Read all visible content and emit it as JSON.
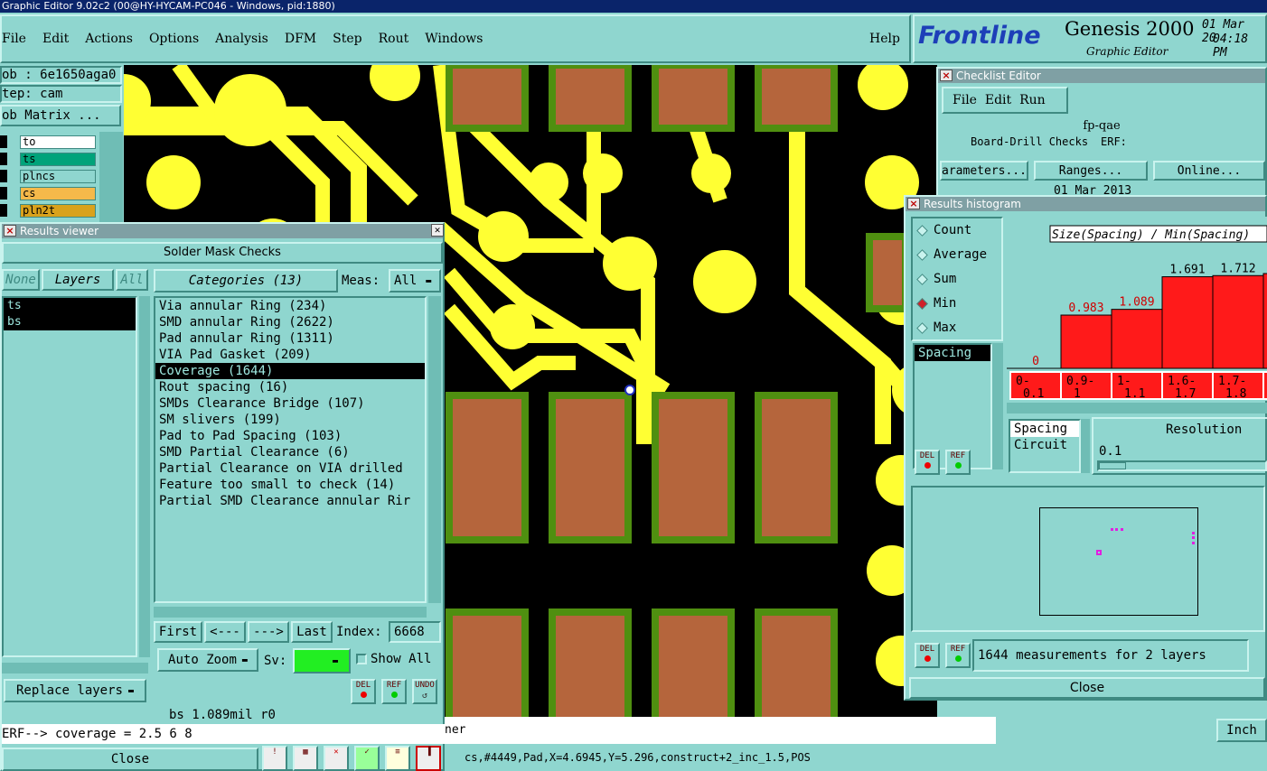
{
  "window_title": "Graphic Editor 9.02c2 (00@HY-HYCAM-PC046 - Windows, pid:1880)",
  "menu": [
    "File",
    "Edit",
    "Actions",
    "Options",
    "Analysis",
    "DFM",
    "Step",
    "Rout",
    "Windows"
  ],
  "help": "Help",
  "brand": {
    "logo": "Frontline",
    "product": "Genesis 2000",
    "subtitle": "Graphic Editor",
    "date": "01 Mar 20",
    "time": "04:18 PM"
  },
  "job": {
    "job_label": "ob : 6e1650aga0",
    "step_label": "tep: cam",
    "matrix_btn": "ob Matrix ..."
  },
  "layers_panel": [
    {
      "name": "to",
      "color": "#ffffff"
    },
    {
      "name": "ts",
      "color": "#00a37a"
    },
    {
      "name": "plncs",
      "color": "#8fd6cf"
    },
    {
      "name": "cs",
      "color": "#f5b94a"
    },
    {
      "name": "pln2t",
      "color": "#d9a21c"
    }
  ],
  "results_viewer": {
    "title": "Results viewer",
    "heading": "Solder Mask Checks",
    "none_btn": "None",
    "layers_btn": "Layers",
    "all_btn": "All",
    "layers": [
      "ts",
      "bs"
    ],
    "categories_btn": "Categories (13)",
    "meas_label": "Meas:",
    "meas_value": "All",
    "categories": [
      "Via annular Ring (234)",
      "SMD annular Ring (2622)",
      "Pad annular Ring (1311)",
      "VIA Pad Gasket (209)",
      "Coverage (1644)",
      "Rout spacing (16)",
      "SMDs Clearance Bridge (107)",
      "SM slivers (199)",
      "Pad to Pad Spacing (103)",
      "SMD Partial Clearance (6)",
      "Partial Clearance on VIA drilled",
      "Feature too small to check (14)",
      "Partial SMD Clearance annular Rir"
    ],
    "selected_category": 4,
    "first": "First",
    "prev": "<---",
    "next": "--->",
    "last": "Last",
    "index_label": "Index:",
    "index_value": "6668",
    "auto_zoom": "Auto Zoom",
    "sv_label": "Sv:",
    "show_all": "Show All",
    "replace_layers": "Replace layers",
    "del": "DEL",
    "ref": "REF",
    "undo": "UNDO",
    "status": "bs 1.089mil  r0",
    "erf": "ERF--> coverage = 2.5 6 8",
    "close": "Close"
  },
  "checklist": {
    "title": "Checklist Editor",
    "menu": [
      "File",
      "Edit",
      "Run"
    ],
    "name": "fp-qae",
    "row1": "Board-Drill Checks",
    "erf_label": "ERF:",
    "parameters": "arameters...",
    "ranges": "Ranges...",
    "online": "Online...",
    "date": "01 Mar 2013"
  },
  "histogram": {
    "title": "Results histogram",
    "modes": [
      "Count",
      "Average",
      "Sum",
      "Min",
      "Max"
    ],
    "selected_mode": 3,
    "measure_list": [
      "Spacing"
    ],
    "chart_title": "Size(Spacing) / Min(Spacing)",
    "resolution_label": "Resolution",
    "resolution_value": "0.1",
    "type_list": [
      "Spacing",
      "Circuit"
    ],
    "summary": "1644 measurements for 2 layers",
    "close": "Close",
    "del": "DEL",
    "ref": "REF"
  },
  "chart_data": {
    "type": "bar",
    "title": "Size(Spacing) / Min(Spacing)",
    "categories": [
      "0-0.1",
      "0.9-1",
      "1-1.1",
      "1.6-1.7",
      "1.7-1.8",
      ""
    ],
    "values": [
      0,
      0.983,
      1.089,
      1.691,
      1.712,
      1.75
    ],
    "labels": [
      "0",
      "0.983",
      "1.089",
      "1.691",
      "1.712",
      ""
    ],
    "colors": {
      "bar": "#ff1a1a",
      "label_red": "#d00000"
    }
  },
  "bottom": {
    "units": "Inch",
    "coords": "cs,#4449,Pad,X=4.6945,Y=5.296,construct+2_inc_1.5,POS",
    "msg": "ner"
  },
  "colors": {
    "bg": "#8fd6cf",
    "board": "#000000",
    "copper": "#ffff33",
    "pad": "#b5653c",
    "pad_edge": "#4f8f10"
  }
}
